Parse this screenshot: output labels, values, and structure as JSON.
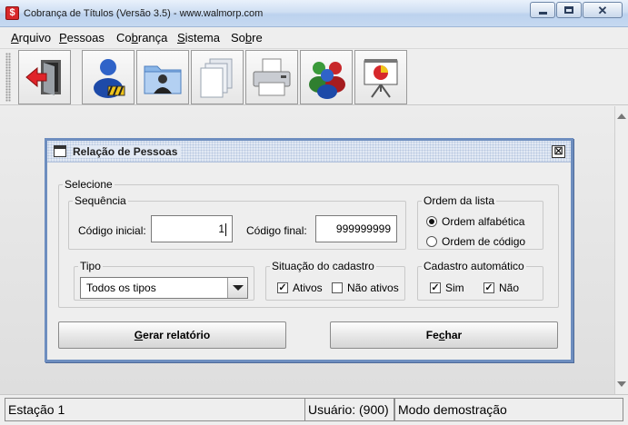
{
  "window": {
    "title": "Cobrança de Títulos (Versão 3.5) - www.walmorp.com",
    "app_icon_letter": "$",
    "controls": {
      "close_glyph": "✕"
    }
  },
  "menu": {
    "items": [
      {
        "pre": "",
        "mnemonic": "A",
        "post": "rquivo"
      },
      {
        "pre": "",
        "mnemonic": "P",
        "post": "essoas"
      },
      {
        "pre": "Co",
        "mnemonic": "b",
        "post": "rança"
      },
      {
        "pre": "",
        "mnemonic": "S",
        "post": "istema"
      },
      {
        "pre": "So",
        "mnemonic": "b",
        "post": "re"
      }
    ]
  },
  "toolbar": {
    "buttons": [
      {
        "icon": "exit-door-icon"
      },
      {
        "icon": "user-edit-icon"
      },
      {
        "icon": "people-folder-icon"
      },
      {
        "icon": "documents-icon"
      },
      {
        "icon": "printer-icon"
      },
      {
        "icon": "users-group-icon"
      },
      {
        "icon": "presentation-chart-icon"
      }
    ]
  },
  "dialog": {
    "title": "Relação de Pessoas",
    "close_glyph": "☒",
    "selecione_legend": "Selecione",
    "sequencia": {
      "legend": "Sequência",
      "inicial_label": "Código inicial:",
      "inicial_value": "1",
      "final_label": "Código final:",
      "final_value": "999999999"
    },
    "ordem": {
      "legend": "Ordem da lista",
      "options": [
        {
          "label": "Ordem alfabética",
          "selected": true
        },
        {
          "label": "Ordem de código",
          "selected": false
        }
      ]
    },
    "tipo": {
      "legend": "Tipo",
      "selected": "Todos os tipos"
    },
    "situacao": {
      "legend": "Situação do cadastro",
      "options": [
        {
          "label": "Ativos",
          "checked": true
        },
        {
          "label": "Não ativos",
          "checked": false
        }
      ]
    },
    "automatico": {
      "legend": "Cadastro automático",
      "options": [
        {
          "label": "Sim",
          "checked": true
        },
        {
          "label": "Não",
          "checked": true
        }
      ]
    },
    "buttons": {
      "gerar": {
        "mnemonic": "G",
        "rest": "erar relatório"
      },
      "fechar": {
        "pre": "Fe",
        "mnemonic": "c",
        "post": "har"
      }
    }
  },
  "status": {
    "estacao": "Estação 1",
    "usuario": "Usuário: (900)",
    "modo": "Modo demostração"
  },
  "colors": {
    "dialog_border": "#6e8ebf",
    "title_bar": "#bcd2ee"
  }
}
